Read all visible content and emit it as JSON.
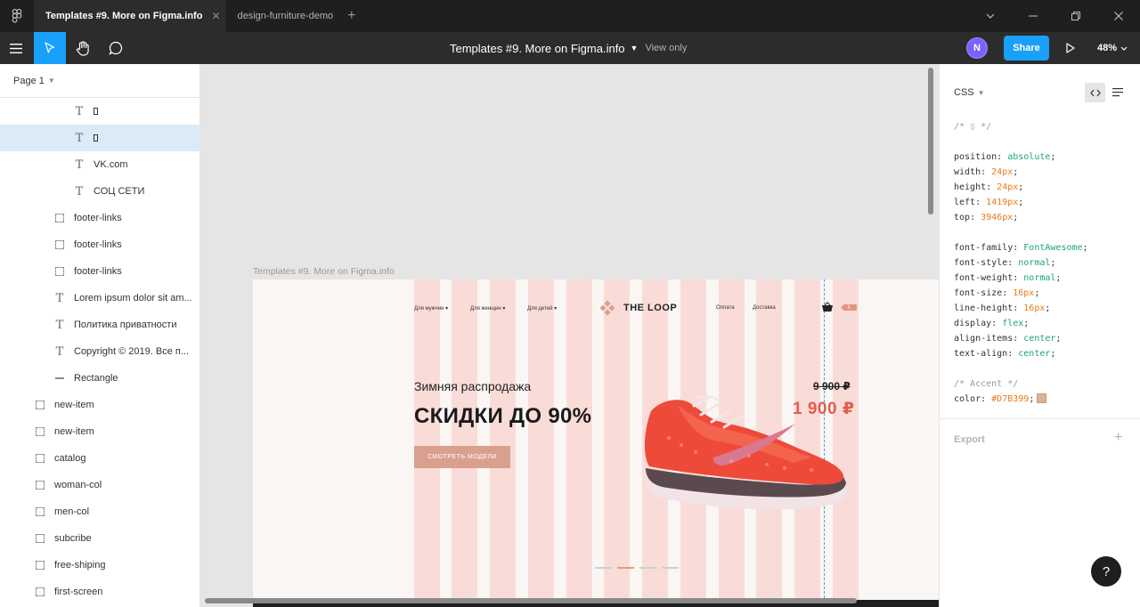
{
  "tabs": [
    {
      "label": "Templates #9. More on Figma.info",
      "active": true
    },
    {
      "label": "design-furniture-demo",
      "active": false
    }
  ],
  "toolbar": {
    "file_name": "Templates #9. More on Figma.info",
    "view_only": "View only",
    "avatar_initial": "N",
    "share_label": "Share",
    "zoom": "48%"
  },
  "layers_panel": {
    "page": "Page 1",
    "items": [
      {
        "type": "text",
        "label": "",
        "glyph": true,
        "indent": 82
      },
      {
        "type": "text",
        "label": "",
        "glyph": true,
        "indent": 82,
        "selected": true
      },
      {
        "type": "text",
        "label": "VK.com",
        "indent": 82
      },
      {
        "type": "text",
        "label": "СОЦ СЕТИ",
        "indent": 82
      },
      {
        "type": "frame",
        "label": "footer-links",
        "indent": 60
      },
      {
        "type": "frame",
        "label": "footer-links",
        "indent": 60
      },
      {
        "type": "frame",
        "label": "footer-links",
        "indent": 60
      },
      {
        "type": "text",
        "label": "Lorem ipsum dolor sit am...",
        "indent": 60
      },
      {
        "type": "text",
        "label": "Политика приватности",
        "indent": 60
      },
      {
        "type": "text",
        "label": "Copyright © 2019. Все п...",
        "indent": 60
      },
      {
        "type": "rect",
        "label": "Rectangle",
        "indent": 60
      },
      {
        "type": "frame",
        "label": "new-item",
        "indent": 38
      },
      {
        "type": "frame",
        "label": "new-item",
        "indent": 38
      },
      {
        "type": "frame",
        "label": "catalog",
        "indent": 38
      },
      {
        "type": "frame",
        "label": "woman-col",
        "indent": 38
      },
      {
        "type": "frame",
        "label": "men-col",
        "indent": 38
      },
      {
        "type": "frame",
        "label": "subcribe",
        "indent": 38
      },
      {
        "type": "frame",
        "label": "free-shiping",
        "indent": 38
      },
      {
        "type": "frame",
        "label": "first-screen",
        "indent": 38
      }
    ]
  },
  "canvas": {
    "frame_label": "Templates #9. More on Figma.info",
    "nav": {
      "men": "Для мужчин ▾",
      "women": "Для женщин ▾",
      "kids": "Для детей ▾",
      "brand": "THE LOOP",
      "payment": "Оплата",
      "delivery": "Доставка",
      "cart_count": "5"
    },
    "hero": {
      "subtitle": "Зимняя распродажа",
      "headline": "СКИДКИ ДО 90%",
      "cta": "СМОТРЕТЬ МОДЕЛИ",
      "old_price": "9 900 ₽",
      "new_price": "1 900 ₽"
    },
    "slider_active_index": 1,
    "colors": {
      "columns": "#f9dcd8",
      "accent": "#e45c4e",
      "cta": "#d9a08f"
    }
  },
  "props_panel": {
    "mode": "CSS",
    "comment_title": "/* ▯ */",
    "code": [
      {
        "prop": "position",
        "value": "absolute",
        "kind": "kw"
      },
      {
        "prop": "width",
        "value": "24px",
        "kind": "num"
      },
      {
        "prop": "height",
        "value": "24px",
        "kind": "num"
      },
      {
        "prop": "left",
        "value": "1419px",
        "kind": "num"
      },
      {
        "prop": "top",
        "value": "3946px",
        "kind": "num"
      }
    ],
    "code2": [
      {
        "prop": "font-family",
        "value": "FontAwesome",
        "kind": "kw"
      },
      {
        "prop": "font-style",
        "value": "normal",
        "kind": "kw"
      },
      {
        "prop": "font-weight",
        "value": "normal",
        "kind": "kw"
      },
      {
        "prop": "font-size",
        "value": "16px",
        "kind": "num"
      },
      {
        "prop": "line-height",
        "value": "16px",
        "kind": "num"
      },
      {
        "prop": "display",
        "value": "flex",
        "kind": "kw"
      },
      {
        "prop": "align-items",
        "value": "center",
        "kind": "kw"
      },
      {
        "prop": "text-align",
        "value": "center",
        "kind": "kw"
      }
    ],
    "accent_comment": "/* Accent */",
    "accent_prop": "color",
    "accent_value": "#D7B399",
    "export_label": "Export"
  }
}
